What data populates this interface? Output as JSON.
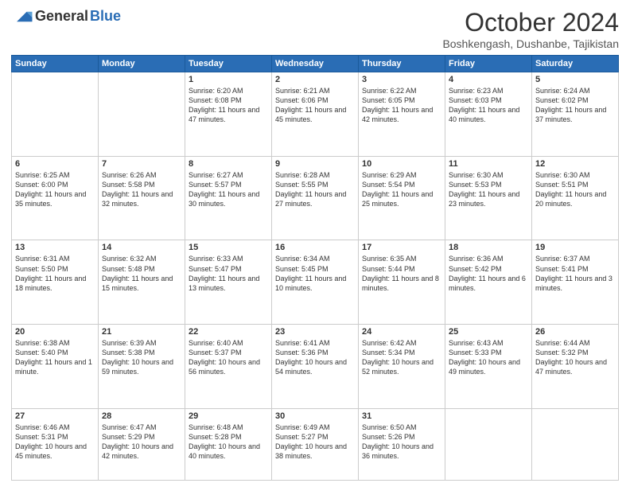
{
  "header": {
    "logo_general": "General",
    "logo_blue": "Blue",
    "title": "October 2024",
    "location": "Boshkengash, Dushanbe, Tajikistan"
  },
  "days_of_week": [
    "Sunday",
    "Monday",
    "Tuesday",
    "Wednesday",
    "Thursday",
    "Friday",
    "Saturday"
  ],
  "weeks": [
    [
      {
        "day": "",
        "info": ""
      },
      {
        "day": "",
        "info": ""
      },
      {
        "day": "1",
        "info": "Sunrise: 6:20 AM\nSunset: 6:08 PM\nDaylight: 11 hours and 47 minutes."
      },
      {
        "day": "2",
        "info": "Sunrise: 6:21 AM\nSunset: 6:06 PM\nDaylight: 11 hours and 45 minutes."
      },
      {
        "day": "3",
        "info": "Sunrise: 6:22 AM\nSunset: 6:05 PM\nDaylight: 11 hours and 42 minutes."
      },
      {
        "day": "4",
        "info": "Sunrise: 6:23 AM\nSunset: 6:03 PM\nDaylight: 11 hours and 40 minutes."
      },
      {
        "day": "5",
        "info": "Sunrise: 6:24 AM\nSunset: 6:02 PM\nDaylight: 11 hours and 37 minutes."
      }
    ],
    [
      {
        "day": "6",
        "info": "Sunrise: 6:25 AM\nSunset: 6:00 PM\nDaylight: 11 hours and 35 minutes."
      },
      {
        "day": "7",
        "info": "Sunrise: 6:26 AM\nSunset: 5:58 PM\nDaylight: 11 hours and 32 minutes."
      },
      {
        "day": "8",
        "info": "Sunrise: 6:27 AM\nSunset: 5:57 PM\nDaylight: 11 hours and 30 minutes."
      },
      {
        "day": "9",
        "info": "Sunrise: 6:28 AM\nSunset: 5:55 PM\nDaylight: 11 hours and 27 minutes."
      },
      {
        "day": "10",
        "info": "Sunrise: 6:29 AM\nSunset: 5:54 PM\nDaylight: 11 hours and 25 minutes."
      },
      {
        "day": "11",
        "info": "Sunrise: 6:30 AM\nSunset: 5:53 PM\nDaylight: 11 hours and 23 minutes."
      },
      {
        "day": "12",
        "info": "Sunrise: 6:30 AM\nSunset: 5:51 PM\nDaylight: 11 hours and 20 minutes."
      }
    ],
    [
      {
        "day": "13",
        "info": "Sunrise: 6:31 AM\nSunset: 5:50 PM\nDaylight: 11 hours and 18 minutes."
      },
      {
        "day": "14",
        "info": "Sunrise: 6:32 AM\nSunset: 5:48 PM\nDaylight: 11 hours and 15 minutes."
      },
      {
        "day": "15",
        "info": "Sunrise: 6:33 AM\nSunset: 5:47 PM\nDaylight: 11 hours and 13 minutes."
      },
      {
        "day": "16",
        "info": "Sunrise: 6:34 AM\nSunset: 5:45 PM\nDaylight: 11 hours and 10 minutes."
      },
      {
        "day": "17",
        "info": "Sunrise: 6:35 AM\nSunset: 5:44 PM\nDaylight: 11 hours and 8 minutes."
      },
      {
        "day": "18",
        "info": "Sunrise: 6:36 AM\nSunset: 5:42 PM\nDaylight: 11 hours and 6 minutes."
      },
      {
        "day": "19",
        "info": "Sunrise: 6:37 AM\nSunset: 5:41 PM\nDaylight: 11 hours and 3 minutes."
      }
    ],
    [
      {
        "day": "20",
        "info": "Sunrise: 6:38 AM\nSunset: 5:40 PM\nDaylight: 11 hours and 1 minute."
      },
      {
        "day": "21",
        "info": "Sunrise: 6:39 AM\nSunset: 5:38 PM\nDaylight: 10 hours and 59 minutes."
      },
      {
        "day": "22",
        "info": "Sunrise: 6:40 AM\nSunset: 5:37 PM\nDaylight: 10 hours and 56 minutes."
      },
      {
        "day": "23",
        "info": "Sunrise: 6:41 AM\nSunset: 5:36 PM\nDaylight: 10 hours and 54 minutes."
      },
      {
        "day": "24",
        "info": "Sunrise: 6:42 AM\nSunset: 5:34 PM\nDaylight: 10 hours and 52 minutes."
      },
      {
        "day": "25",
        "info": "Sunrise: 6:43 AM\nSunset: 5:33 PM\nDaylight: 10 hours and 49 minutes."
      },
      {
        "day": "26",
        "info": "Sunrise: 6:44 AM\nSunset: 5:32 PM\nDaylight: 10 hours and 47 minutes."
      }
    ],
    [
      {
        "day": "27",
        "info": "Sunrise: 6:46 AM\nSunset: 5:31 PM\nDaylight: 10 hours and 45 minutes."
      },
      {
        "day": "28",
        "info": "Sunrise: 6:47 AM\nSunset: 5:29 PM\nDaylight: 10 hours and 42 minutes."
      },
      {
        "day": "29",
        "info": "Sunrise: 6:48 AM\nSunset: 5:28 PM\nDaylight: 10 hours and 40 minutes."
      },
      {
        "day": "30",
        "info": "Sunrise: 6:49 AM\nSunset: 5:27 PM\nDaylight: 10 hours and 38 minutes."
      },
      {
        "day": "31",
        "info": "Sunrise: 6:50 AM\nSunset: 5:26 PM\nDaylight: 10 hours and 36 minutes."
      },
      {
        "day": "",
        "info": ""
      },
      {
        "day": "",
        "info": ""
      }
    ]
  ]
}
